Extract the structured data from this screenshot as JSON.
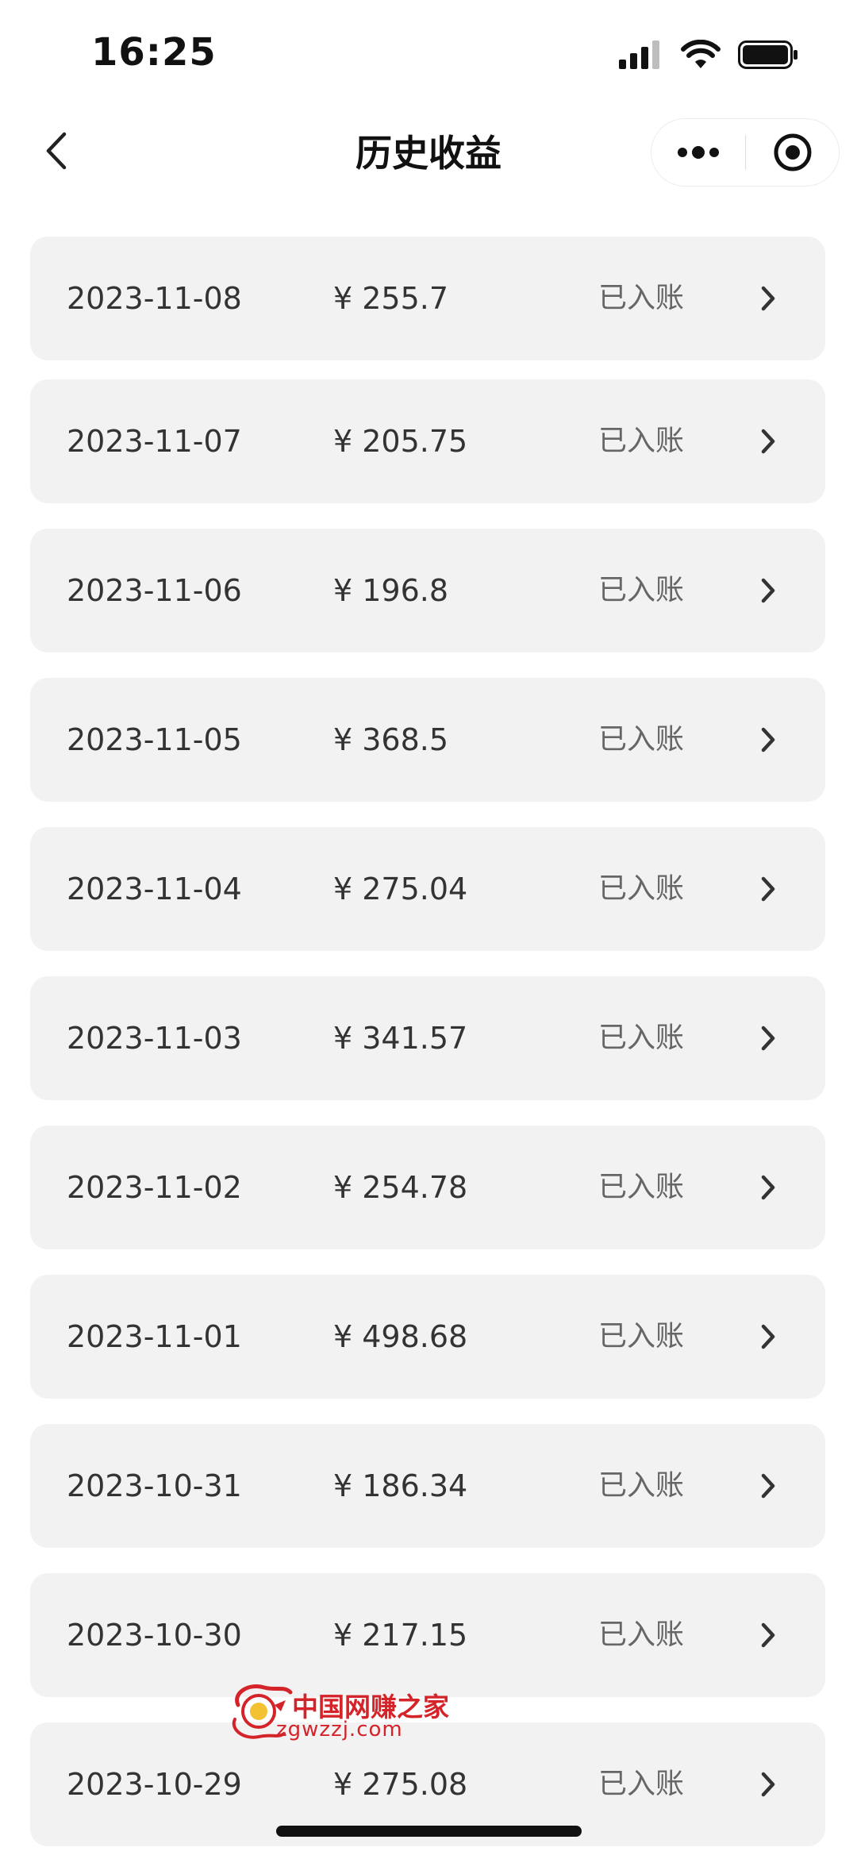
{
  "status_bar": {
    "time": "16:25"
  },
  "nav": {
    "title": "历史收益",
    "back_icon": "chevron-left-icon",
    "more_icon": "more-dots-icon",
    "close_icon": "target-close-icon"
  },
  "records": [
    {
      "date": "2023-11-08",
      "amount": "¥ 255.7",
      "status": "已入账"
    },
    {
      "date": "2023-11-07",
      "amount": "¥ 205.75",
      "status": "已入账"
    },
    {
      "date": "2023-11-06",
      "amount": "¥ 196.8",
      "status": "已入账"
    },
    {
      "date": "2023-11-05",
      "amount": "¥ 368.5",
      "status": "已入账"
    },
    {
      "date": "2023-11-04",
      "amount": "¥ 275.04",
      "status": "已入账"
    },
    {
      "date": "2023-11-03",
      "amount": "¥ 341.57",
      "status": "已入账"
    },
    {
      "date": "2023-11-02",
      "amount": "¥ 254.78",
      "status": "已入账"
    },
    {
      "date": "2023-11-01",
      "amount": "¥ 498.68",
      "status": "已入账"
    },
    {
      "date": "2023-10-31",
      "amount": "¥ 186.34",
      "status": "已入账"
    },
    {
      "date": "2023-10-30",
      "amount": "¥ 217.15",
      "status": "已入账"
    },
    {
      "date": "2023-10-29",
      "amount": "¥ 275.08",
      "status": "已入账"
    }
  ],
  "watermark": {
    "name": "中国网赚之家",
    "site": "zgwzzj.com"
  },
  "colors": {
    "row_bg": "#f2f2f2",
    "text": "#333333",
    "status_text": "#666666",
    "watermark": "#d4242a"
  }
}
